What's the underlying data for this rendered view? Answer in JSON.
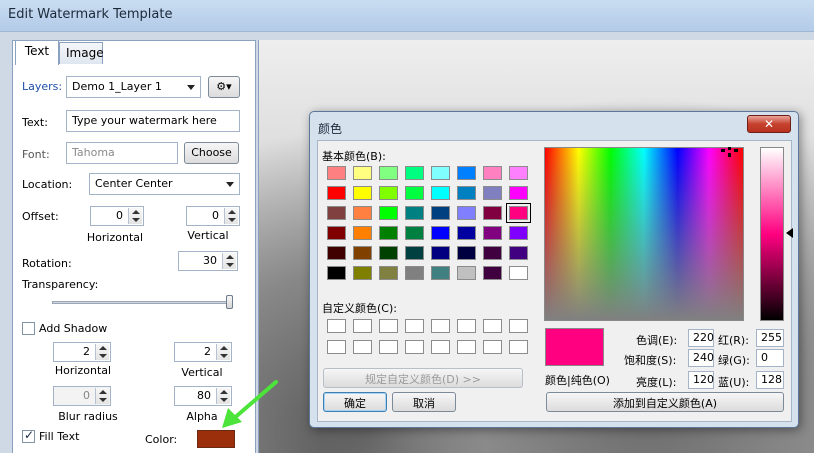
{
  "window": {
    "title": "Edit Watermark Template"
  },
  "tabs": [
    {
      "label": "Text",
      "active": true
    },
    {
      "label": "Image",
      "active": false
    }
  ],
  "form": {
    "layers_label": "Layers:",
    "layers_value": "Demo 1_Layer 1",
    "layers_menu_icon": "gear-icon",
    "text_label": "Text:",
    "text_value": "Type your watermark here",
    "font_label": "Font:",
    "font_value": "Tahoma",
    "choose_button": "Choose",
    "location_label": "Location:",
    "location_value": "Center Center",
    "offset_label": "Offset:",
    "offset_h_value": "0",
    "offset_v_value": "0",
    "horizontal_label": "Horizontal",
    "vertical_label": "Vertical",
    "rotation_label": "Rotation:",
    "rotation_value": "30",
    "transparency_label": "Transparency:",
    "transparency_level": 1.0,
    "add_shadow_label": "Add Shadow",
    "add_shadow_checked": false,
    "shadow_h_value": "2",
    "shadow_v_value": "2",
    "shadow_h_label": "Horizontal",
    "shadow_v_label": "Vertical",
    "blur_value": "0",
    "blur_label": "Blur radius",
    "alpha_value": "80",
    "alpha_label": "Alpha",
    "fill_text_label": "Fill Text",
    "fill_text_checked": true,
    "color_label": "Color:",
    "fill_color": "#9b2f0c"
  },
  "color_dialog": {
    "title": "颜色",
    "close_icon": "close-icon",
    "basic_colors_label": "基本颜色(B):",
    "basic_colors": [
      [
        "#ff8080",
        "#ffff80",
        "#80ff80",
        "#00ff80",
        "#80ffff",
        "#0080ff",
        "#ff80c0",
        "#ff80ff"
      ],
      [
        "#ff0000",
        "#ffff00",
        "#80ff00",
        "#00ff40",
        "#00ffff",
        "#0080c0",
        "#8080c0",
        "#ff00ff"
      ],
      [
        "#804040",
        "#ff8040",
        "#00ff00",
        "#008080",
        "#004080",
        "#8080ff",
        "#800040",
        "#ff0080"
      ],
      [
        "#800000",
        "#ff8000",
        "#008000",
        "#008040",
        "#0000ff",
        "#0000a0",
        "#800080",
        "#8000ff"
      ],
      [
        "#400000",
        "#804000",
        "#004000",
        "#004040",
        "#000080",
        "#000040",
        "#400040",
        "#400080"
      ],
      [
        "#000000",
        "#808000",
        "#808040",
        "#808080",
        "#408080",
        "#c0c0c0",
        "#400040",
        "#ffffff"
      ]
    ],
    "selected_swatch": [
      2,
      7
    ],
    "custom_colors_label": "自定义颜色(C):",
    "define_custom_button": "规定自定义颜色(D) >>",
    "ok_button": "确定",
    "cancel_button": "取消",
    "color_solid_label": "颜色|纯色(O)",
    "hue_label": "色调(E):",
    "hue_value": "220",
    "sat_label": "饱和度(S):",
    "sat_value": "240",
    "lum_label": "亮度(L):",
    "lum_value": "120",
    "red_label": "红(R):",
    "red_value": "255",
    "green_label": "绿(G):",
    "green_value": "0",
    "blue_label": "蓝(U):",
    "blue_value": "128",
    "add_custom_button": "添加到自定义颜色(A)",
    "current_color": "#ff0080"
  },
  "annotation": {
    "arrow_color": "#4ce33a",
    "arrow_icon": "green-arrow-icon"
  }
}
